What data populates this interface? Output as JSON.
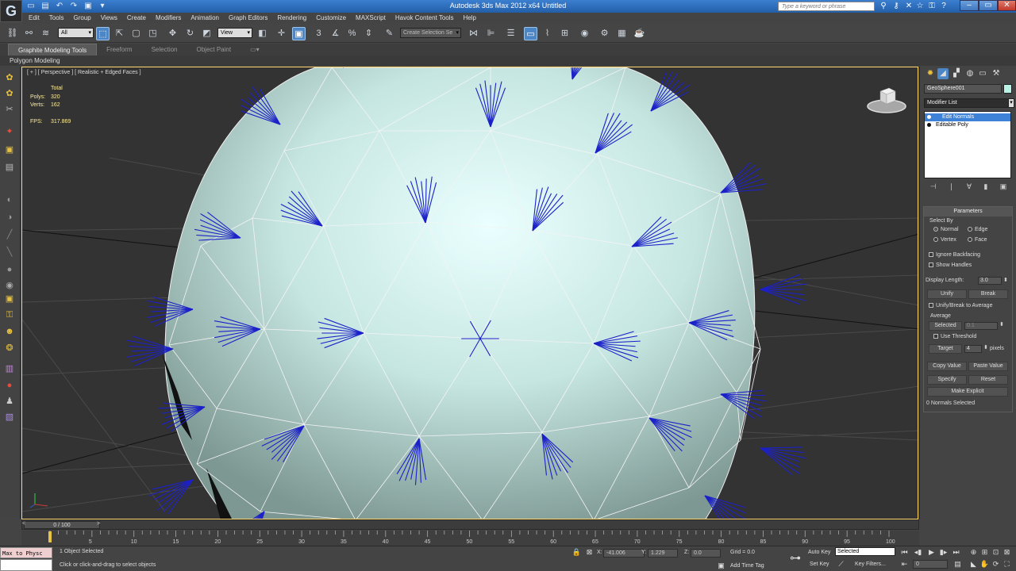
{
  "window": {
    "title": "Autodesk 3ds Max 2012 x64    Untitled",
    "search_placeholder": "Type a keyword or phrase"
  },
  "logo": "G",
  "quick_access": [
    "▭",
    "▤",
    "↶",
    "↷",
    "▣",
    "▾"
  ],
  "menu": [
    "Edit",
    "Tools",
    "Group",
    "Views",
    "Create",
    "Modifiers",
    "Animation",
    "Graph Editors",
    "Rendering",
    "Customize",
    "MAXScript",
    "Havok Content Tools",
    "Help"
  ],
  "toolbar": {
    "filter_value": "All",
    "view_value": "View",
    "selection_set": "Create Selection Se"
  },
  "ribbon": {
    "tabs": [
      "Graphite Modeling Tools",
      "Freeform",
      "Selection",
      "Object Paint"
    ],
    "polygon_modeling": "Polygon Modeling"
  },
  "viewport": {
    "label": "[ + ] [ Perspective ] [ Realistic + Edged Faces ]",
    "stats": {
      "total_label": "Total",
      "polys_label": "Polys:",
      "polys": "320",
      "verts_label": "Verts:",
      "verts": "162",
      "fps_label": "FPS:",
      "fps": "317.869"
    }
  },
  "command_panel": {
    "object_name": "GeoSphere001",
    "object_color": "#b8f2e4",
    "modifier_list": "Modifier List",
    "stack": [
      "Edit Normals",
      "Editable Poly"
    ],
    "params_title": "Parameters",
    "select_by": "Select By",
    "normal": "Normal",
    "edge": "Edge",
    "vertex": "Vertex",
    "face": "Face",
    "ignore_backfacing": "Ignore Backfacing",
    "show_handles": "Show Handles",
    "display_length_label": "Display Length:",
    "display_length": "3.0",
    "unify": "Unify",
    "break": "Break",
    "unify_break_avg": "Unify/Break to Average",
    "average": "Average",
    "selected_btn": "Selected",
    "selected_val": "0.1",
    "use_threshold": "Use Threshold",
    "target_btn": "Target",
    "target_val": "4",
    "pixels": "pixels",
    "copy_value": "Copy Value",
    "paste_value": "Paste Value",
    "specify": "Specify",
    "reset": "Reset",
    "make_explicit": "Make Explicit",
    "normals_selected": "0 Normals Selected"
  },
  "timeline": {
    "slider": "0 / 100",
    "ticks": [
      "5",
      "10",
      "15",
      "20",
      "25",
      "30",
      "35",
      "40",
      "45",
      "50",
      "55",
      "60",
      "65",
      "70",
      "75",
      "80",
      "85",
      "90",
      "95",
      "100"
    ]
  },
  "status": {
    "maxscript1": "Max to Physc",
    "selected": "1 Object Selected",
    "prompt": "Click or click-and-drag to select objects",
    "x_label": "X:",
    "x": "-41.006",
    "y_label": "Y:",
    "y": "1.229",
    "z_label": "Z:",
    "z": "0.0",
    "grid": "Grid = 0.0",
    "add_time_tag": "Add Time Tag",
    "auto_key": "Auto Key",
    "set_key": "Set Key",
    "selected_dd": "Selected",
    "key_filters": "Key Filters...",
    "frame": "0"
  }
}
